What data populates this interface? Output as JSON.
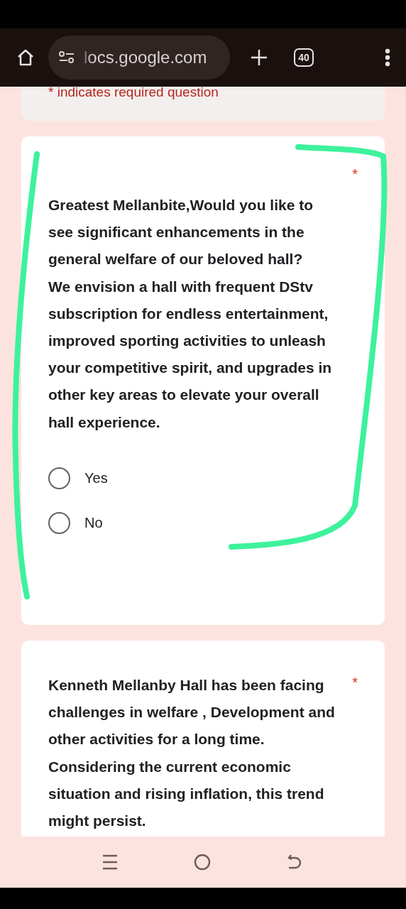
{
  "browser": {
    "url": "locs.google.com",
    "tab_count": "40"
  },
  "form": {
    "required_note": "* indicates required question",
    "questions": [
      {
        "paragraphs": [
          "Greatest Mellanbite,Would you like to see significant enhancements in the general welfare of our beloved hall?",
          "We envision a hall with frequent DStv subscription for endless entertainment, improved sporting activities to unleash your competitive spirit, and upgrades in other key areas to elevate your overall hall experience."
        ],
        "required_mark": "*",
        "options": [
          {
            "label": "Yes",
            "selected": false
          },
          {
            "label": "No",
            "selected": false
          }
        ]
      },
      {
        "paragraphs": [
          "Kenneth Mellanby Hall has been facing challenges in welfare , Development and other activities for a long time. Considering the current economic situation and rising inflation, this trend might persist."
        ],
        "required_mark": "*"
      }
    ]
  }
}
